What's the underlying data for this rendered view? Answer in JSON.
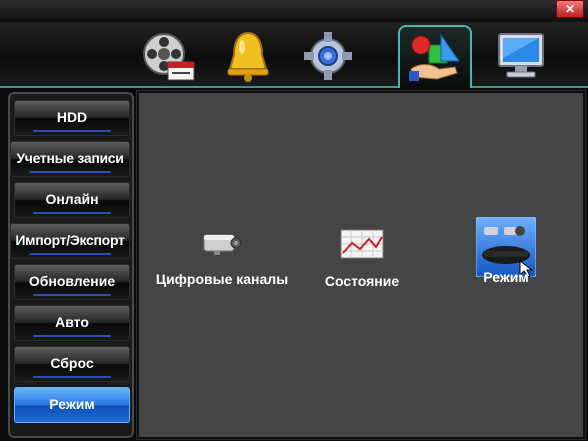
{
  "window": {
    "close_label": "✕"
  },
  "tabs": [
    {
      "name": "record",
      "icon": "film-reel-icon"
    },
    {
      "name": "alarm",
      "icon": "bell-icon"
    },
    {
      "name": "system",
      "icon": "gear-icon"
    },
    {
      "name": "advanced",
      "icon": "management-icon",
      "active": true
    },
    {
      "name": "info",
      "icon": "monitor-icon"
    }
  ],
  "sidebar": {
    "items": [
      {
        "label": "HDD"
      },
      {
        "label": "Учетные записи"
      },
      {
        "label": "Онлайн"
      },
      {
        "label": "Импорт/Экспорт"
      },
      {
        "label": "Обновление"
      },
      {
        "label": "Авто"
      },
      {
        "label": "Сброс"
      },
      {
        "label": "Режим",
        "active": true
      }
    ]
  },
  "main": {
    "items": [
      {
        "label": "Цифровые каналы",
        "icon": "camera-icon"
      },
      {
        "label": "Состояние",
        "icon": "chart-icon"
      },
      {
        "label": "Режим",
        "icon": "dvr-mode-icon",
        "selected": true
      }
    ]
  },
  "colors": {
    "accent": "#4ab8a8",
    "active_blue": "#2876e0",
    "panel_bg": "#454545"
  }
}
